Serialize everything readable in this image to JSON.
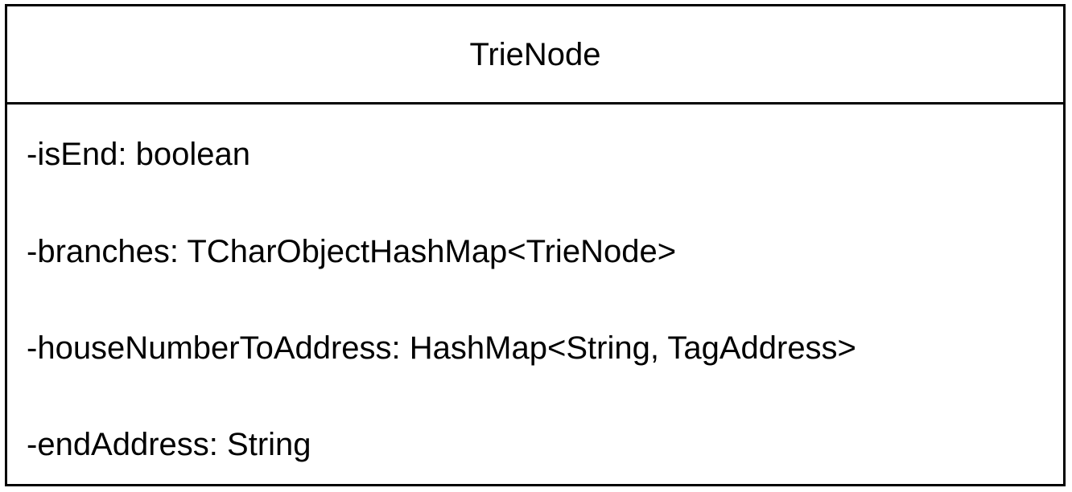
{
  "class_box": {
    "name": "TrieNode",
    "attributes": [
      "-isEnd: boolean",
      "-branches: TCharObjectHashMap<TrieNode>",
      "-houseNumberToAddress: HashMap<String, TagAddress>",
      "-endAddress: String"
    ]
  },
  "colors": {
    "border": "#000000",
    "background": "#ffffff",
    "text": "#000000"
  }
}
